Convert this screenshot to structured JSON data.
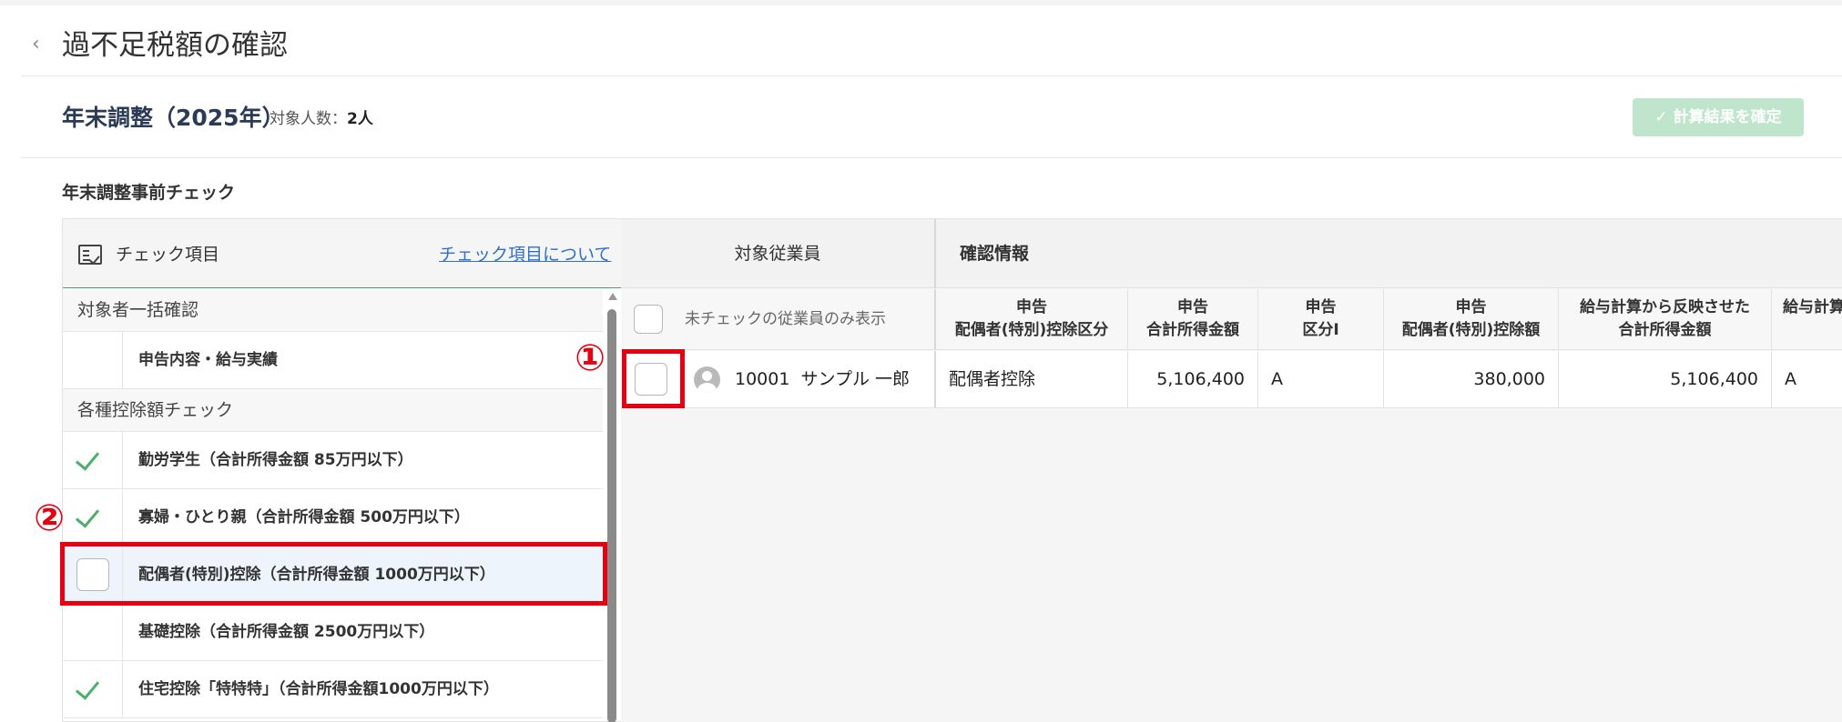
{
  "header": {
    "back_icon": "chevron-left-icon",
    "title": "過不足税額の確認"
  },
  "summary": {
    "year_title": "年末調整（2025年）",
    "count_label": "対象人数：",
    "count_value": "2人",
    "confirm_button": "計算結果を確定",
    "confirm_icon": "check-icon"
  },
  "precheck": {
    "section_title": "年末調整事前チェック",
    "panel_title": "チェック項目",
    "panel_icon": "checklist-icon",
    "about_link": "チェック項目について",
    "groups": [
      {
        "label": "対象者一括確認",
        "items": [
          {
            "label": "申告内容・給与実績",
            "status": "none"
          }
        ]
      },
      {
        "label": "各種控除額チェック",
        "items": [
          {
            "label": "勤労学生（合計所得金額 85万円以下）",
            "status": "checked"
          },
          {
            "label": "寡婦・ひとり親（合計所得金額 500万円以下）",
            "status": "checked"
          },
          {
            "label": "配偶者(特別)控除（合計所得金額 1000万円以下）",
            "status": "checkbox",
            "selected": true
          },
          {
            "label": "基礎控除（合計所得金額 2500万円以下）",
            "status": "none"
          },
          {
            "label": "住宅控除「特特特」（合計所得金額1000万円以下）",
            "status": "checked"
          }
        ]
      }
    ]
  },
  "table": {
    "employee_group": "対象従業員",
    "info_group": "確認情報",
    "filter_label": "未チェックの従業員のみ表示",
    "columns": [
      {
        "line1": "申告",
        "line2": "配偶者(特別)控除区分"
      },
      {
        "line1": "申告",
        "line2": "合計所得金額"
      },
      {
        "line1": "申告",
        "line2": "区分Ⅰ"
      },
      {
        "line1": "申告",
        "line2": "配偶者(特別)控除額"
      },
      {
        "line1": "給与計算から反映させた",
        "line2": "合計所得金額"
      },
      {
        "line1": "給与計算",
        "line2": ""
      }
    ],
    "rows": [
      {
        "employee_id": "10001",
        "employee_name": "サンプル 一郎",
        "avatar_icon": "user-avatar-icon",
        "cells": [
          "配偶者控除",
          "5,106,400",
          "A",
          "380,000",
          "5,106,400",
          "A"
        ]
      }
    ]
  },
  "annotations": {
    "marker_1": "①",
    "marker_2": "②",
    "color": "#e60012"
  },
  "colors": {
    "accent_green": "#43a25f",
    "confirm_disabled": "#bfe5cc",
    "link_blue": "#2f6fd1"
  }
}
